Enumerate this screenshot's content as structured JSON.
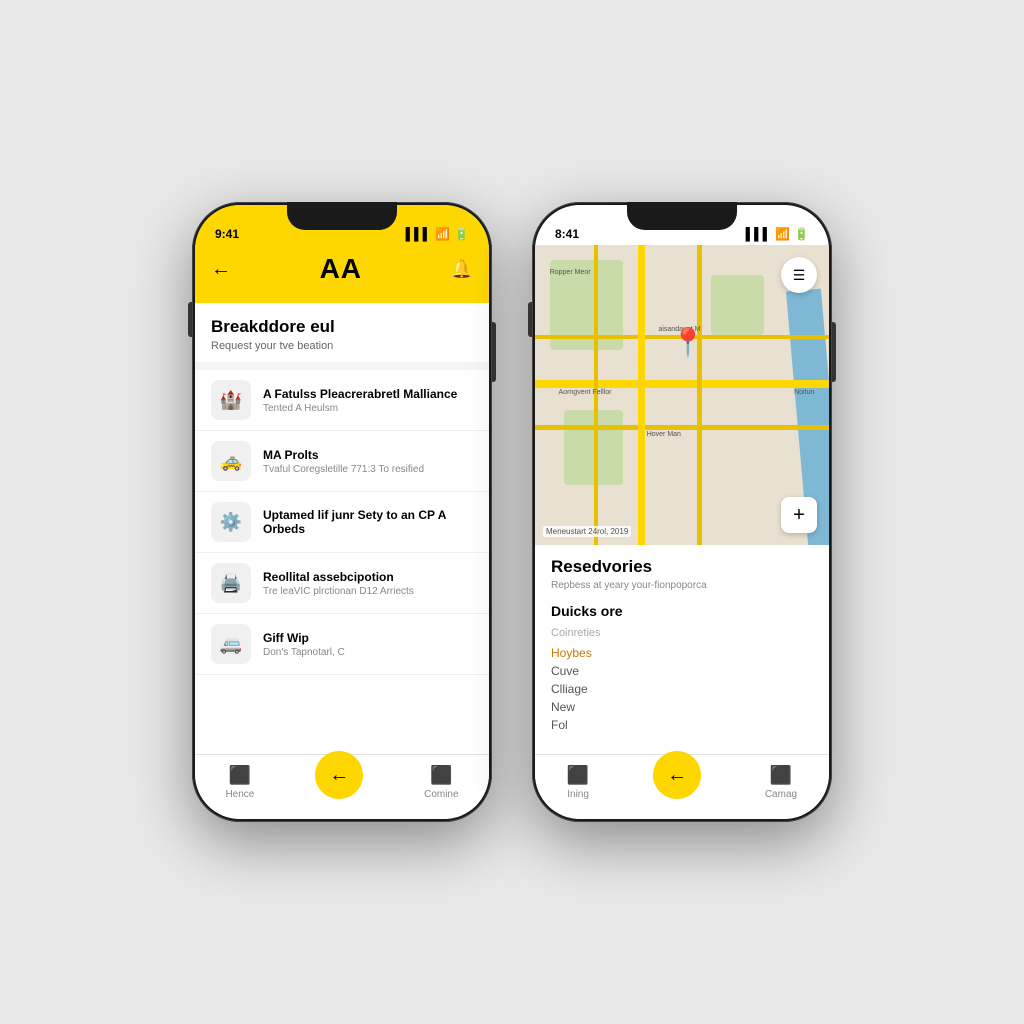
{
  "background": "#e8e8e8",
  "phone1": {
    "status_time": "9:41",
    "logo": "AA",
    "header_title": "Breakddore eul",
    "header_subtitle": "Request your tve beation",
    "services": [
      {
        "icon": "🏰",
        "title": "A Fatulss Pleacrerabretl Malliance",
        "subtitle": "Tented A Heulsm"
      },
      {
        "icon": "🚗",
        "title": "MA Prolts",
        "subtitle": "Tvaful Coregsletille 771:3 To resified"
      },
      {
        "icon": "⚙️",
        "title": "Uptamed lif junr Sety to an CP A Orbeds",
        "subtitle": ""
      },
      {
        "icon": "🖨️",
        "title": "Reollital assebcipotion",
        "subtitle": "Tre leaVIC plrctionan D12 Arriects"
      },
      {
        "icon": "🚐",
        "title": "Giff Wip",
        "subtitle": "Don's Tapnotarl, C"
      }
    ],
    "nav": {
      "left_label": "Hence",
      "center_icon": "←",
      "right_label": "Comine"
    }
  },
  "phone2": {
    "status_time": "8:41",
    "map_label": "Meneustart 24rol, 2019",
    "section_title": "Resedvories",
    "section_subtitle": "Repbess at yeary your-fionpoporca",
    "quick_title": "Duicks ore",
    "category_label": "Coinreties",
    "category_items": [
      {
        "label": "Hoybes",
        "highlight": true
      },
      {
        "label": "Cuve",
        "highlight": false
      },
      {
        "label": "Clliage",
        "highlight": false
      },
      {
        "label": "New",
        "highlight": false
      },
      {
        "label": "Fol",
        "highlight": false
      }
    ],
    "nav": {
      "left_label": "Ining",
      "center_icon": "←",
      "right_label": "Camag"
    }
  }
}
